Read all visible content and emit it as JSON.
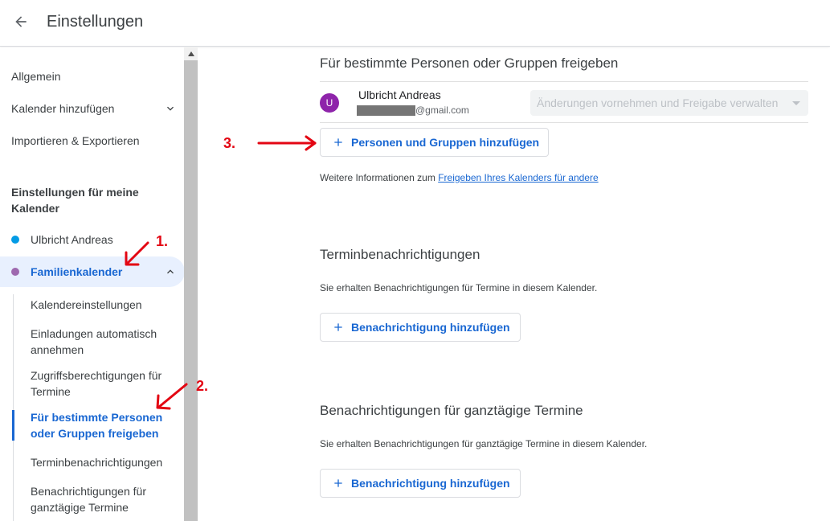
{
  "header": {
    "title": "Einstellungen"
  },
  "sidebar": {
    "items": [
      {
        "label": "Allgemein"
      },
      {
        "label": "Kalender hinzufügen"
      },
      {
        "label": "Importieren & Exportieren"
      }
    ],
    "section_heading": "Einstellungen für meine Kalender",
    "calendars": [
      {
        "label": "Ulbricht Andreas",
        "color": "#039be5"
      },
      {
        "label": "Familienkalender",
        "color": "#9e69af"
      }
    ],
    "subitems": [
      {
        "label": "Kalendereinstellungen"
      },
      {
        "label": "Einladungen automatisch annehmen"
      },
      {
        "label": "Zugriffsberechtigungen für Termine"
      },
      {
        "label": "Für bestimmte Personen oder Gruppen freigeben"
      },
      {
        "label": "Terminbenachrichtigungen"
      },
      {
        "label": "Benachrichtigungen für ganztägige Termine"
      }
    ]
  },
  "main": {
    "share_section": {
      "title": "Für bestimmte Personen oder Gruppen freigeben",
      "person": {
        "initial": "U",
        "name": "Ulbricht Andreas",
        "email_suffix": "@gmail.com",
        "permission": "Änderungen vornehmen und Freigabe verwalten"
      },
      "add_button": "Personen und Gruppen hinzufügen",
      "info_prefix": "Weitere Informationen zum ",
      "info_link": "Freigeben Ihres Kalenders für andere"
    },
    "event_notifications": {
      "title": "Terminbenachrichtigungen",
      "description": "Sie erhalten Benachrichtigungen für Termine in diesem Kalender.",
      "add_button": "Benachrichtigung hinzufügen"
    },
    "allday_notifications": {
      "title": "Benachrichtigungen für ganztägige Termine",
      "description": "Sie erhalten Benachrichtigungen für ganztägige Termine in diesem Kalender.",
      "add_button": "Benachrichtigung hinzufügen"
    }
  },
  "annotations": {
    "step1": "1.",
    "step2": "2.",
    "step3": "3.",
    "color": "#e30613"
  },
  "accent_color": "#1967d2"
}
